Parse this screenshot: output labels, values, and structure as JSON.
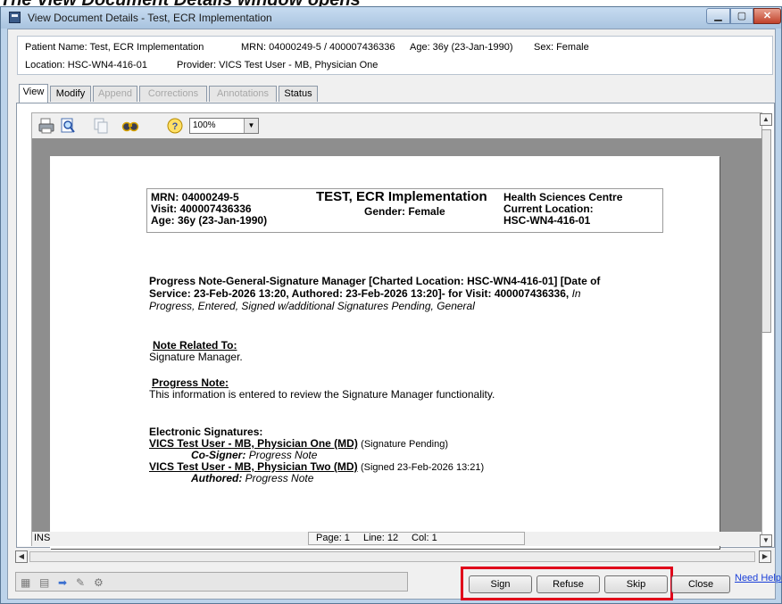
{
  "caption": "The View Document Details window opens",
  "window": {
    "title": "View Document Details - Test, ECR Implementation"
  },
  "header": {
    "patient_name": "Patient Name: Test, ECR Implementation",
    "mrn": "MRN: 04000249-5 / 400007436336",
    "age": "Age: 36y (23-Jan-1990)",
    "sex": "Sex: Female",
    "location": "Location: HSC-WN4-416-01",
    "provider": "Provider: VICS Test User - MB, Physician One"
  },
  "tabs": [
    {
      "label": "View"
    },
    {
      "label": "Modify"
    },
    {
      "label": "Append"
    },
    {
      "label": "Corrections"
    },
    {
      "label": "Annotations"
    },
    {
      "label": "Status"
    }
  ],
  "toolbar": {
    "zoom_value": "100%"
  },
  "document": {
    "demo": {
      "mrn": "MRN: 04000249-5",
      "visit": "Visit: 400007436336",
      "age": "Age: 36y (23-Jan-1990)",
      "name": "TEST, ECR Implementation",
      "gender": "Gender: Female",
      "facility": "Health Sciences Centre",
      "current_location_label": "Current Location:",
      "current_location": "HSC-WN4-416-01"
    },
    "note_title_line1": "Progress Note-General-Signature Manager [Charted Location: HSC-WN4-416-01] [Date of",
    "note_title_line2": "Service: 23-Feb-2026 13:20, Authored: 23-Feb-2026 13:20]- for Visit: 400007436336,",
    "note_title_status_a": "In",
    "note_title_status_b": "Progress, Entered, Signed w/additional Signatures Pending, General",
    "related_heading": "Note Related To:",
    "related_text": "Signature Manager.",
    "progress_heading": "Progress Note:",
    "progress_text": "This information is entered to review the Signature Manager functionality.",
    "esig_heading": "Electronic Signatures:",
    "sig1_name": "VICS Test User - MB, Physician One (MD)",
    "sig1_status": "(Signature Pending)",
    "sig1_role_label": "Co-Signer:",
    "sig1_role_value": "Progress Note",
    "sig2_name": "VICS Test User - MB, Physician Two (MD)",
    "sig2_status": "(Signed 23-Feb-2026 13:21)",
    "sig2_role_label": "Authored:",
    "sig2_role_value": "Progress Note"
  },
  "status_bar": {
    "mode": "INS",
    "page": "Page: 1",
    "line": "Line: 12",
    "col": "Col: 1"
  },
  "buttons": {
    "sign": "Sign",
    "refuse": "Refuse",
    "skip": "Skip",
    "close": "Close",
    "help": "Need Help?"
  },
  "colors": {
    "highlight": "#e0001a",
    "link": "#1a3fd8",
    "window_frame": "#bcd3ea"
  }
}
